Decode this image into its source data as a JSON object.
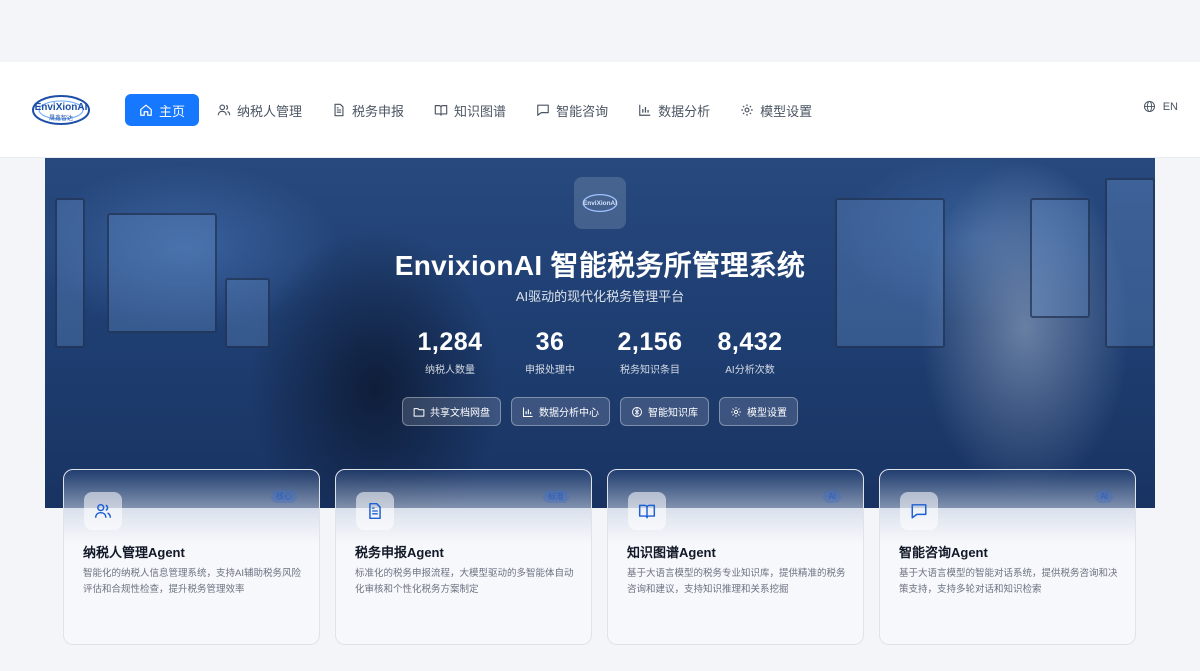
{
  "brand": {
    "logo_text": "EnviXionAI",
    "logo_sub": "晟鑫智达"
  },
  "nav": {
    "items": [
      {
        "label": "主页",
        "icon": "home-icon",
        "active": true
      },
      {
        "label": "纳税人管理",
        "icon": "users-icon"
      },
      {
        "label": "税务申报",
        "icon": "document-icon"
      },
      {
        "label": "知识图谱",
        "icon": "book-icon"
      },
      {
        "label": "智能咨询",
        "icon": "chat-icon"
      },
      {
        "label": "数据分析",
        "icon": "bar-chart-icon"
      },
      {
        "label": "模型设置",
        "icon": "gear-icon"
      }
    ],
    "lang": "EN"
  },
  "hero": {
    "title": "EnvixionAI 智能税务所管理系统",
    "subtitle": "AI驱动的现代化税务管理平台",
    "stats": [
      {
        "value": "1,284",
        "label": "纳税人数量"
      },
      {
        "value": "36",
        "label": "申报处理中"
      },
      {
        "value": "2,156",
        "label": "税务知识条目"
      },
      {
        "value": "8,432",
        "label": "AI分析次数"
      }
    ],
    "quick_links": [
      {
        "label": "共享文档网盘",
        "icon": "folder-icon"
      },
      {
        "label": "数据分析中心",
        "icon": "bar-chart-icon"
      },
      {
        "label": "智能知识库",
        "icon": "brain-icon"
      },
      {
        "label": "模型设置",
        "icon": "gear-icon"
      }
    ]
  },
  "cards": [
    {
      "title": "纳税人管理Agent",
      "desc": "智能化的纳税人信息管理系统，支持AI辅助税务风险评估和合规性检查，提升税务管理效率",
      "badge": "核心",
      "icon": "users-icon"
    },
    {
      "title": "税务申报Agent",
      "desc": "标准化的税务申报流程，大模型驱动的多智能体自动化审核和个性化税务方案制定",
      "badge": "标准",
      "icon": "document-icon"
    },
    {
      "title": "知识图谱Agent",
      "desc": "基于大语言模型的税务专业知识库，提供精准的税务咨询和建议，支持知识推理和关系挖掘",
      "badge": "AI",
      "icon": "book-icon"
    },
    {
      "title": "智能咨询Agent",
      "desc": "基于大语言模型的智能对话系统，提供税务咨询和决策支持，支持多轮对话和知识检索",
      "badge": "AI",
      "icon": "chat-icon"
    }
  ],
  "colors": {
    "primary": "#1677ff",
    "hero_bg": "#22457c"
  }
}
